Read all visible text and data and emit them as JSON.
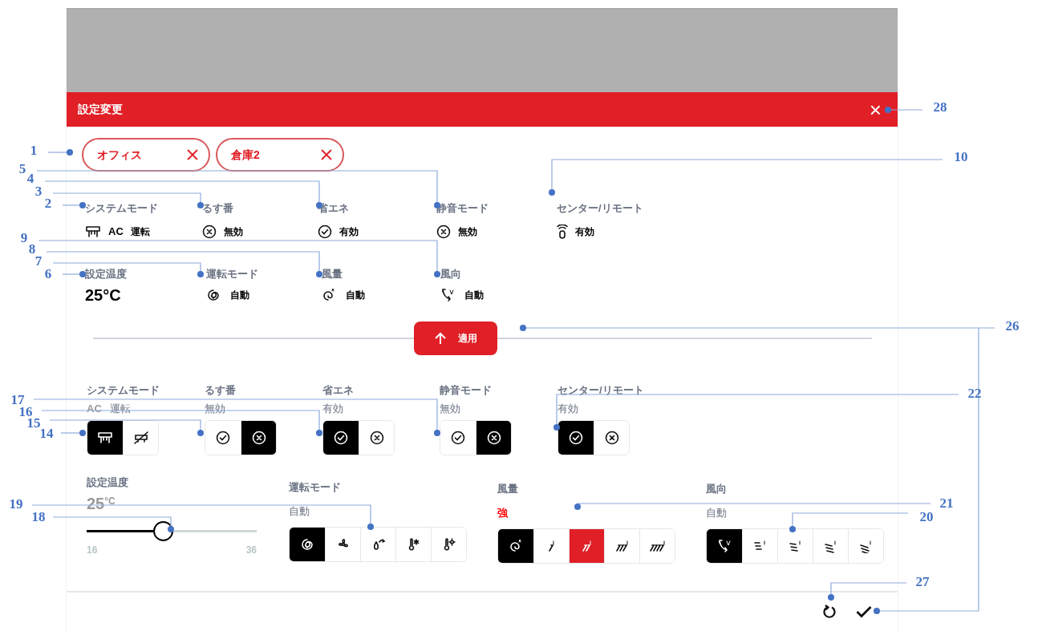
{
  "header": {
    "title": "設定変更",
    "close": "×"
  },
  "chips": [
    {
      "label": "オフィス"
    },
    {
      "label": "倉庫2"
    }
  ],
  "summary_row_1": [
    {
      "kind": "system",
      "label": "システムモード",
      "badge": "AC",
      "value": "運転"
    },
    {
      "kind": "toggle",
      "label": "るす番",
      "enabled": false,
      "value": "無効"
    },
    {
      "kind": "toggle",
      "label": "省エネ",
      "enabled": true,
      "value": "有効"
    },
    {
      "kind": "toggle",
      "label": "静音モード",
      "enabled": false,
      "value": "無効"
    },
    {
      "kind": "remote",
      "label": "センター/リモート",
      "value": "有効"
    }
  ],
  "summary_row_2": [
    {
      "kind": "temperature",
      "label": "設定温度",
      "value": "25°C"
    },
    {
      "kind": "mode",
      "label": "運転モード",
      "value": "自動"
    },
    {
      "kind": "fan",
      "label": "風量",
      "value": "自動"
    },
    {
      "kind": "direction",
      "label": "風向",
      "value": "自動"
    }
  ],
  "apply_button": {
    "label": "適用"
  },
  "controls_row_1": [
    {
      "kind": "system",
      "label": "システムモード",
      "badge": "AC",
      "value": "運転",
      "options": [
        {
          "current": true,
          "selected": false
        },
        {
          "current": false,
          "selected": false
        }
      ]
    },
    {
      "kind": "toggle",
      "label": "るす番",
      "value": "無効",
      "options": [
        {
          "current": false,
          "selected": false
        },
        {
          "current": true,
          "selected": false
        }
      ]
    },
    {
      "kind": "toggle",
      "label": "省エネ",
      "value": "有効",
      "options": [
        {
          "current": true,
          "selected": false
        },
        {
          "current": false,
          "selected": false
        }
      ]
    },
    {
      "kind": "toggle",
      "label": "静音モード",
      "value": "無効",
      "options": [
        {
          "current": false,
          "selected": false
        },
        {
          "current": true,
          "selected": false
        }
      ]
    },
    {
      "kind": "toggle",
      "label": "センター/リモート",
      "value": "有効",
      "options": [
        {
          "current": true,
          "selected": false
        },
        {
          "current": false,
          "selected": false
        }
      ]
    }
  ],
  "temperature": {
    "label": "設定温度",
    "value": "25$^{°C}$",
    "min": "16",
    "max": "36",
    "level": 0.45
  },
  "controls_row_2": [
    {
      "kind": "mode",
      "label": "運転モード",
      "value": "自動",
      "changed": false,
      "options": [
        {
          "current": true,
          "selected": false
        },
        {
          "current": false,
          "selected": false
        },
        {
          "current": false,
          "selected": false
        },
        {
          "current": false,
          "selected": false
        },
        {
          "current": false,
          "selected": false
        }
      ]
    },
    {
      "kind": "fan",
      "label": "風量",
      "value": "強",
      "changed": true,
      "options": [
        {
          "current": true,
          "selected": false
        },
        {
          "current": false,
          "selected": false
        },
        {
          "current": false,
          "selected": true
        },
        {
          "current": false,
          "selected": false
        },
        {
          "current": false,
          "selected": false
        }
      ]
    },
    {
      "kind": "direction",
      "label": "風向",
      "value": "自動",
      "changed": false,
      "options": [
        {
          "current": true,
          "selected": false
        },
        {
          "current": false,
          "selected": false
        },
        {
          "current": false,
          "selected": false
        },
        {
          "current": false,
          "selected": false
        },
        {
          "current": false,
          "selected": false
        }
      ]
    }
  ],
  "callouts": [
    {
      "number": "1"
    },
    {
      "number": "2"
    },
    {
      "number": "3"
    },
    {
      "number": "4"
    },
    {
      "number": "5"
    },
    {
      "number": "6"
    },
    {
      "number": "7"
    },
    {
      "number": "8"
    },
    {
      "number": "9"
    },
    {
      "number": "10"
    },
    {
      "number": "14"
    },
    {
      "number": "15"
    },
    {
      "number": "16"
    },
    {
      "number": "17"
    },
    {
      "number": "18"
    },
    {
      "number": "19"
    },
    {
      "number": "20"
    },
    {
      "number": "21"
    },
    {
      "number": "22"
    },
    {
      "number": "26"
    },
    {
      "number": "27"
    },
    {
      "number": "28"
    }
  ]
}
